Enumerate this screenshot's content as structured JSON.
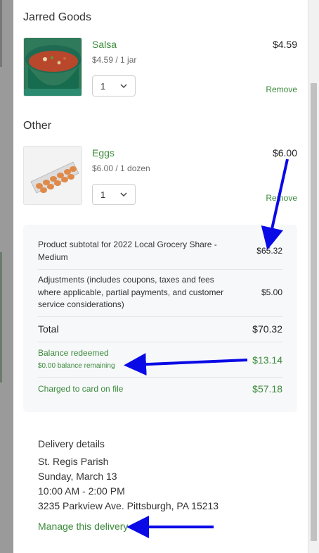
{
  "sections": [
    {
      "title": "Jarred Goods",
      "item": {
        "name": "Salsa",
        "unit": "$4.59 / 1 jar",
        "qty": "1",
        "price": "$4.59",
        "remove": "Remove",
        "image_icon": "salsa-bowl-photo"
      }
    },
    {
      "title": "Other",
      "item": {
        "name": "Eggs",
        "unit": "$6.00 / 1 dozen",
        "qty": "1",
        "price": "$6.00",
        "remove": "Remove",
        "image_icon": "egg-carton-photo"
      }
    }
  ],
  "summary": {
    "subtotal_label": "Product subtotal for 2022 Local Grocery Share - Medium",
    "subtotal_value": "$65.32",
    "adjust_label": "Adjustments (includes coupons, taxes and fees where applicable, partial payments, and customer service considerations)",
    "adjust_value": "$5.00",
    "total_label": "Total",
    "total_value": "$70.32",
    "balance_label": "Balance redeemed",
    "balance_remaining": "$0.00 balance remaining",
    "balance_value": "$13.14",
    "charged_label": "Charged to card on file",
    "charged_value": "$57.18"
  },
  "delivery": {
    "heading": "Delivery details",
    "location": "St. Regis Parish",
    "date": "Sunday, March 13",
    "time": "10:00 AM - 2:00 PM",
    "address": "3235 Parkview Ave. Pittsburgh, PA 15213",
    "manage_link": "Manage this delivery"
  },
  "colors": {
    "accent_green": "#3b8a3b",
    "annotation_arrow": "#0a0ae6"
  }
}
